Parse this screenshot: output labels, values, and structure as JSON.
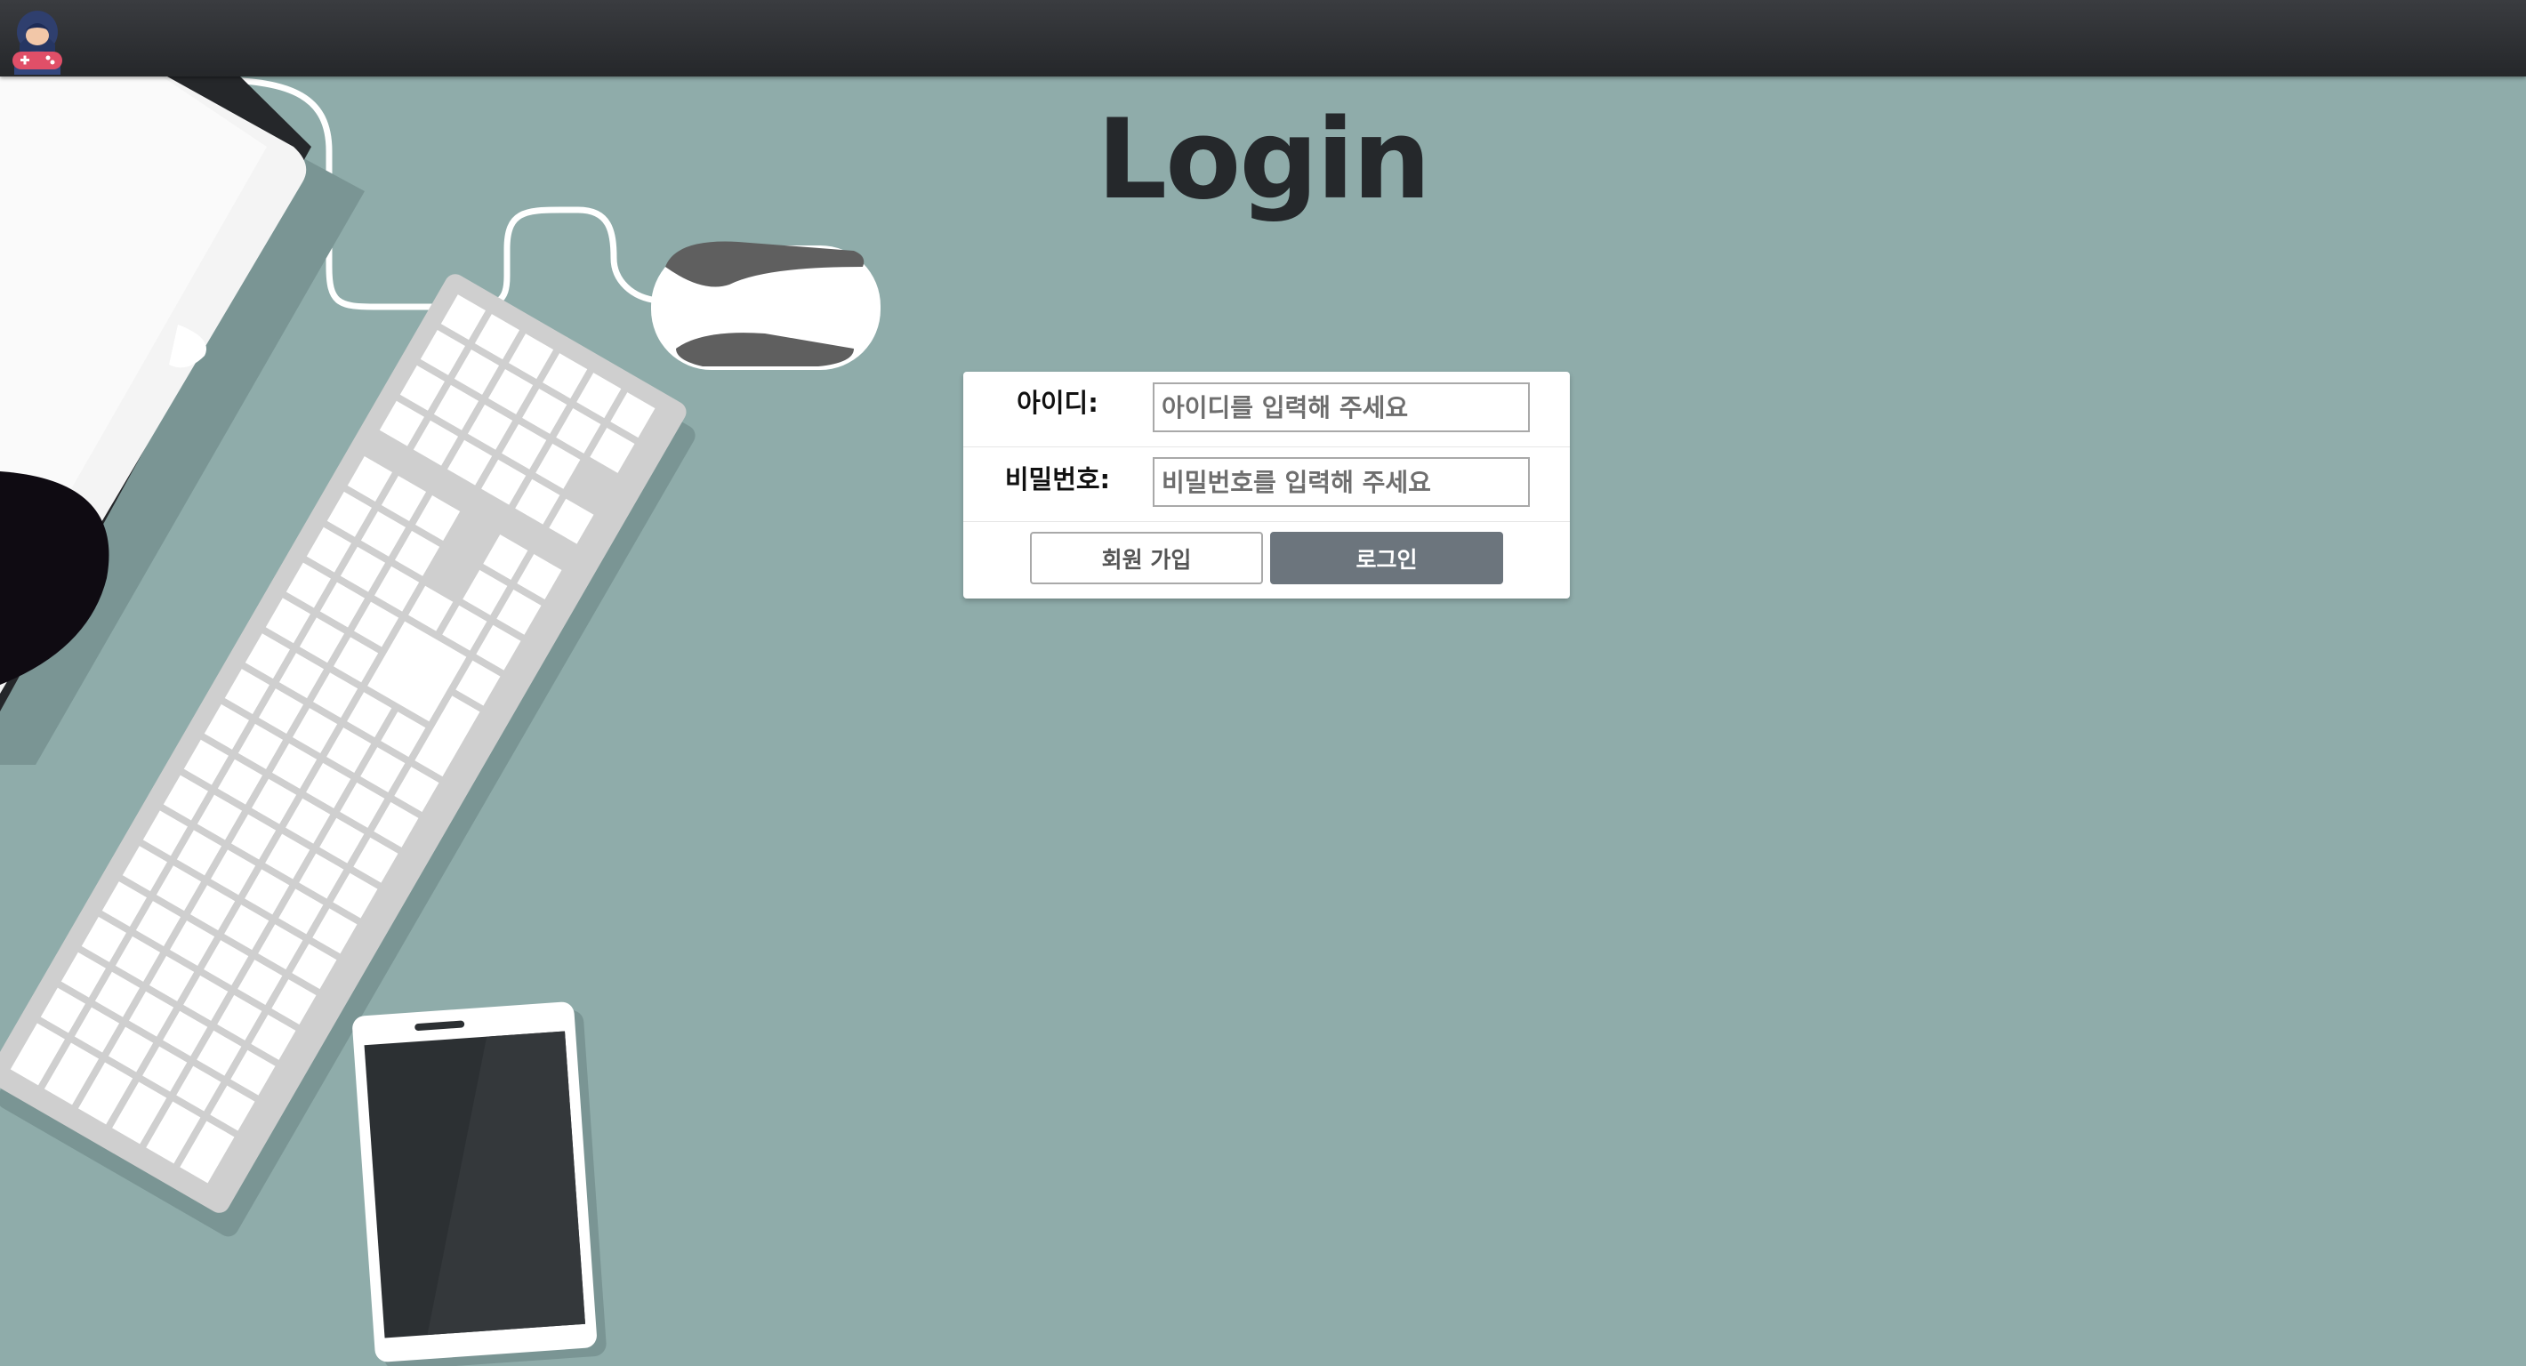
{
  "header": {
    "logo_icon": "gamer-avatar-icon"
  },
  "page": {
    "title": "Login"
  },
  "form": {
    "id_label": "아이디:",
    "id_placeholder": "아이디를 입력해 주세요",
    "id_value": "",
    "password_label": "비밀번호:",
    "password_placeholder": "비밀번호를 입력해 주세요",
    "password_value": "",
    "signup_label": "회원 가입",
    "login_label": "로그인"
  },
  "colors": {
    "background": "#8facaa",
    "login_button": "#6c757d",
    "title": "#25282b"
  },
  "background_illustration": {
    "items": [
      "monitor",
      "keyboard",
      "mouse",
      "smartphone"
    ]
  }
}
